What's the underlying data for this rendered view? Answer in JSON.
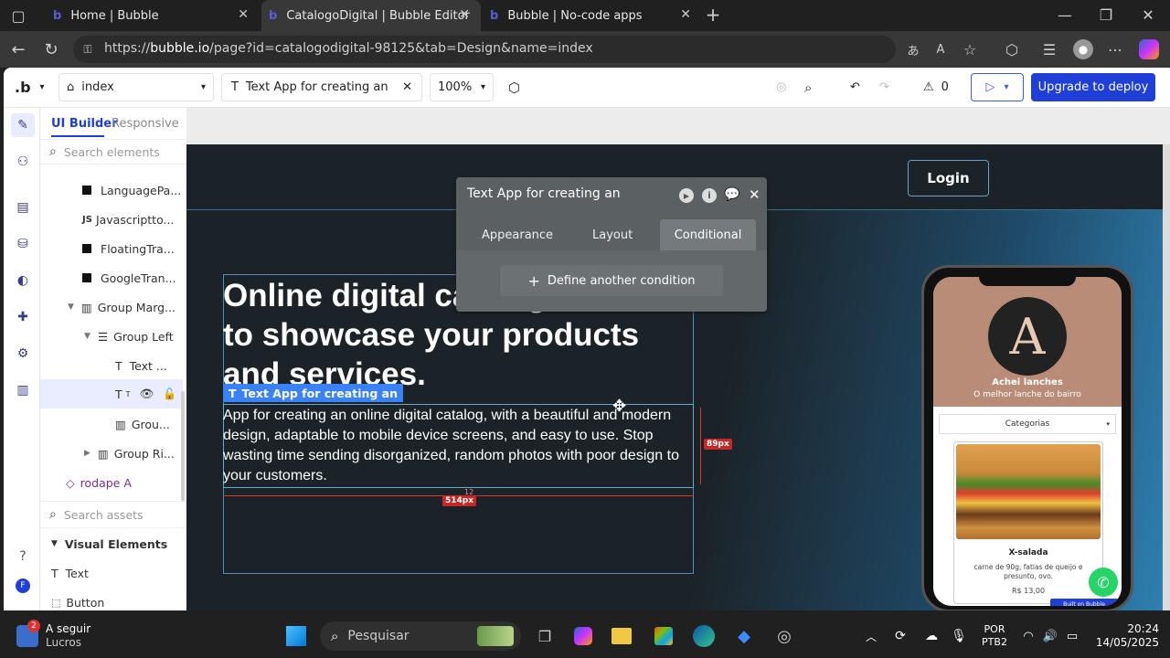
{
  "browser": {
    "tabs": [
      {
        "label": "Home | Bubble"
      },
      {
        "label": "CatalogoDigital | Bubble Editor"
      },
      {
        "label": "Bubble | No-code apps"
      }
    ],
    "url_prefix": "https://",
    "url_host": "bubble.io",
    "url_path": "/page?id=catalogodigital-98125&tab=Design&name=index"
  },
  "editor": {
    "logo": ".b",
    "page_select": "index",
    "element_title": "Text App for creating an",
    "zoom": "100%",
    "issues_count": "0",
    "deploy_label": "Upgrade to deploy"
  },
  "panel": {
    "tabs": [
      "UI Builder",
      "Responsive"
    ],
    "search_elements_placeholder": "Search elements",
    "tree": [
      {
        "label": "LanguagePa...",
        "icon": "square"
      },
      {
        "label": "Javascriptto...",
        "icon": "JS"
      },
      {
        "label": "FloatingTra...",
        "icon": "square"
      },
      {
        "label": "GoogleTran...",
        "icon": "square"
      },
      {
        "label": "Group Marg...",
        "icon": "columns"
      },
      {
        "label": "Group Left",
        "icon": "rows"
      },
      {
        "label": "Text ...",
        "icon": "T"
      },
      {
        "label": "T",
        "icon": "T"
      },
      {
        "label": "Grou...",
        "icon": "columns"
      },
      {
        "label": "Group Ri...",
        "icon": "columns"
      },
      {
        "label": "rodape A",
        "icon": "diamond"
      }
    ],
    "search_assets_placeholder": "Search assets",
    "visual_elements_label": "Visual Elements",
    "visual_items": [
      "Text",
      "Button"
    ]
  },
  "property_editor": {
    "title": "Text App for creating an",
    "tabs": [
      "Appearance",
      "Layout",
      "Conditional"
    ],
    "define_condition": "Define another condition"
  },
  "canvas": {
    "login": "Login",
    "heading": "Online digital catalog created to showcase your products and services.",
    "selected_label": "Text App for creating an",
    "body": "App for creating an online digital catalog, with a beautiful and modern design, adaptable to mobile device screens, and easy to use. Stop wasting time sending disorganized, random photos with poor design to your customers.",
    "width_px": "514px",
    "height_px": "89px",
    "gap": "12"
  },
  "phone": {
    "brand": "Achei lanches",
    "tagline": "O melhor lanche do bairro",
    "category": "Categorias",
    "product_name": "X-salada",
    "product_desc": "carne de 90g, fatias de queijo e presunto, ovo.",
    "price": "R$ 13,00",
    "built_on": "Built on Bubble"
  },
  "taskbar": {
    "weather_badge": "2",
    "weather_title": "A seguir",
    "weather_sub": "Lucros",
    "search_label": "Pesquisar",
    "lang1": "POR",
    "lang2": "PTB2",
    "time": "20:24",
    "date": "14/05/2025"
  }
}
